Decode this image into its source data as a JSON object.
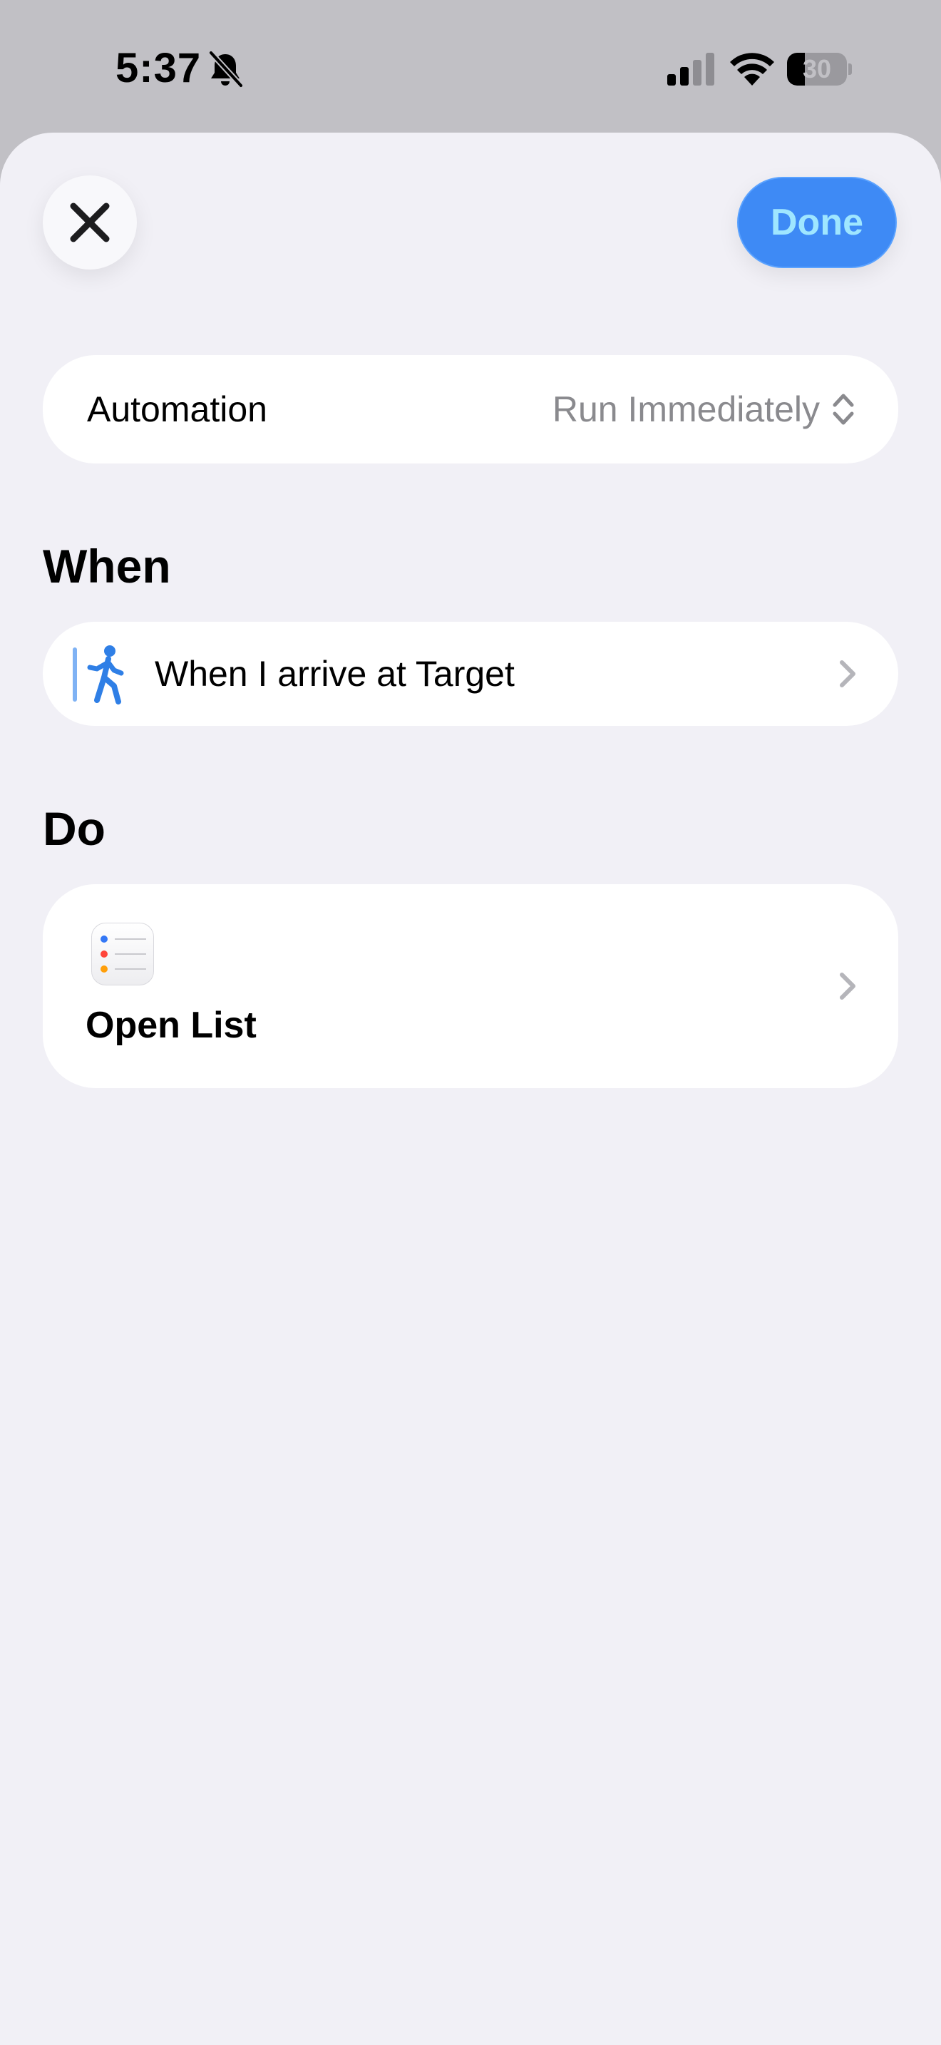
{
  "status_bar": {
    "time": "5:37",
    "battery_level": "30",
    "battery_fraction": 0.3,
    "icons": [
      "bell-slash-icon",
      "cellular-signal-icon",
      "wifi-icon",
      "battery-icon"
    ]
  },
  "header": {
    "close_icon": "close-icon",
    "done_label": "Done"
  },
  "automation": {
    "label": "Automation",
    "value": "Run Immediately",
    "icon": "chevron-up-down-icon"
  },
  "when": {
    "heading": "When",
    "trigger_text": "When I arrive at Target",
    "icon": "walking-person-icon"
  },
  "do": {
    "heading": "Do",
    "action_text": "Open List",
    "icon": "reminders-app-icon"
  },
  "colors": {
    "accent": "#3e8af5",
    "done_text": "#9fe6ff",
    "background": "#f1f0f6",
    "card": "#ffffff",
    "secondary_text": "#8a8a8e",
    "status_bar_bg": "#c1c0c5"
  }
}
